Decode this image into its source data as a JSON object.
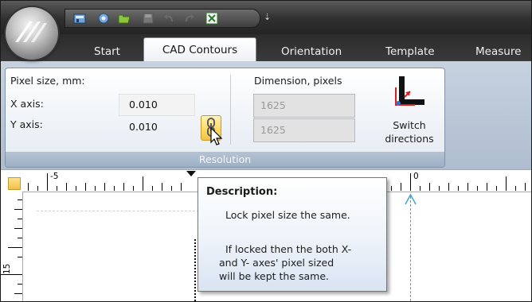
{
  "app": {
    "quick_access_icons": [
      "home-icon",
      "tools-icon",
      "open-folder-icon",
      "save-icon",
      "undo-icon",
      "redo-icon",
      "export-icon"
    ],
    "qat_more": "⇣"
  },
  "tabs": [
    {
      "label": "Start",
      "active": false
    },
    {
      "label": "CAD Contours",
      "active": true
    },
    {
      "label": "Orientation",
      "active": false
    },
    {
      "label": "Template",
      "active": false
    },
    {
      "label": "Measure",
      "active": false
    }
  ],
  "resolution_group": {
    "pixel_size_label": "Pixel size, mm:",
    "x_axis_label": "X axis:",
    "x_axis_value": "0.010",
    "y_axis_label": "Y axis:",
    "y_axis_value": "0.010",
    "dimension_label": "Dimension, pixels",
    "dimension_x": "1625",
    "dimension_y": "1625",
    "switch_label_1": "Switch",
    "switch_label_2": "directions",
    "footer": "Resolution"
  },
  "ruler": {
    "top_labels": [
      "-5",
      "0"
    ],
    "left_label": "15"
  },
  "tooltip": {
    "title": "Description:",
    "line1": "Lock pixel size the same.",
    "line2": "If locked then the both X-",
    "line3": "and Y- axes' pixel sized",
    "line4": "will be kept the same."
  },
  "colors": {
    "ribbon_top": "#c6d2e0",
    "tab_bar": "#2c2c2c",
    "lock_button": "#ffd862",
    "guide_line": "#3aa9c9"
  }
}
